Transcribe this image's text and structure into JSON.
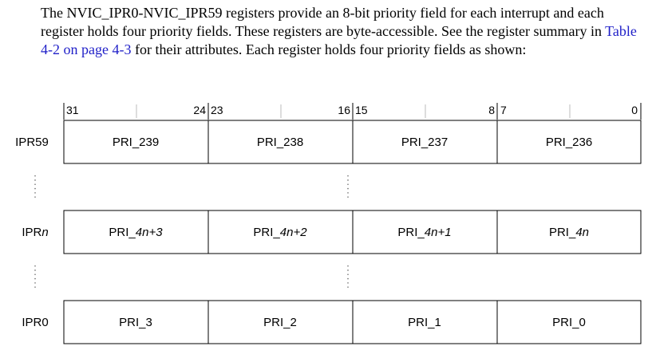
{
  "paragraph": {
    "text_before": "The NVIC_IPR0-NVIC_IPR59 registers provide an 8-bit priority field for each interrupt and each register holds four priority fields. These registers are byte-accessible. See the register summary in ",
    "link_text": "Table 4-2 on page 4-3",
    "text_after": " for their attributes. Each register holds four priority fields as shown:",
    "link_color": "#1f1fc8"
  },
  "bit_header": {
    "b31": "31",
    "b24": "24",
    "b23": "23",
    "b16": "16",
    "b15": "15",
    "b8": "8",
    "b7": "7",
    "b0": "0"
  },
  "registers": [
    {
      "name_prefix": "IPR",
      "name_suffix": "59",
      "fields": [
        "PRI_239",
        "PRI_238",
        "PRI_237",
        "PRI_236"
      ]
    },
    {
      "name_prefix": "IPR",
      "name_suffix": "n",
      "fields": [
        {
          "prefix": "PRI_",
          "suffix": "4n+3"
        },
        {
          "prefix": "PRI_",
          "suffix": "4n+2"
        },
        {
          "prefix": "PRI_",
          "suffix": "4n+1"
        },
        {
          "prefix": "PRI_",
          "suffix": "4n"
        }
      ]
    },
    {
      "name_prefix": "IPR",
      "name_suffix": "0",
      "fields": [
        "PRI_3",
        "PRI_2",
        "PRI_1",
        "PRI_0"
      ]
    }
  ]
}
